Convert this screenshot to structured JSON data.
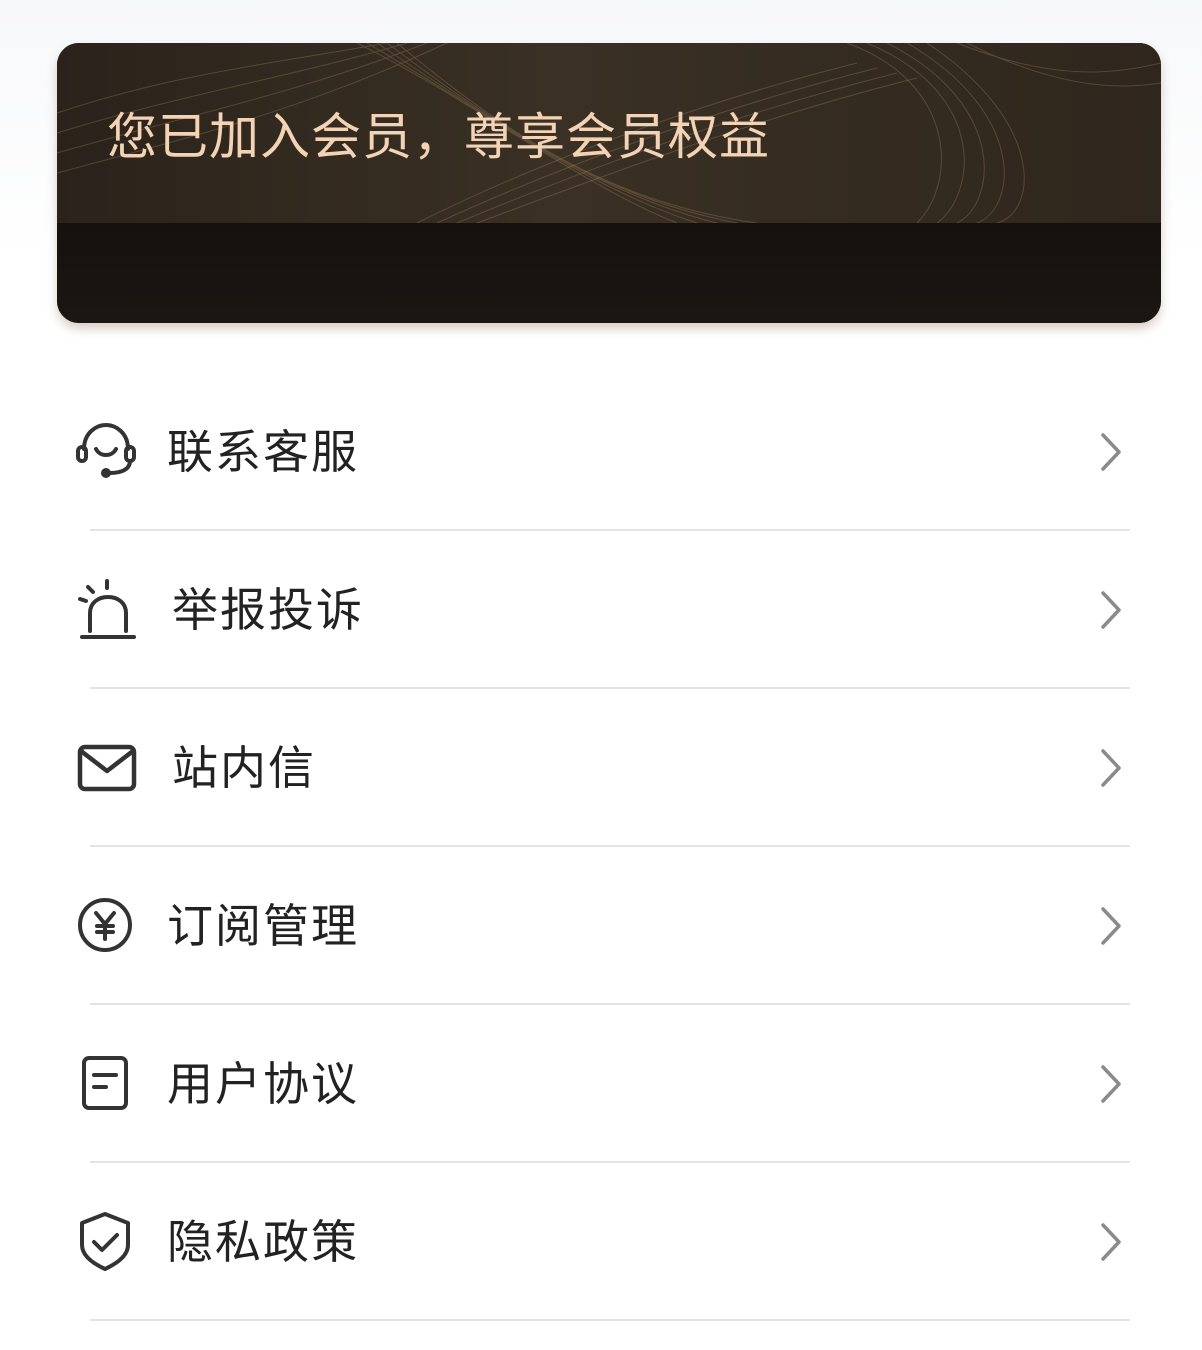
{
  "banner": {
    "text": "您已加入会员，尊享会员权益",
    "text_color": "#f3d3b5",
    "background_color": "#1a1511"
  },
  "menu": {
    "items": [
      {
        "label": "联系客服",
        "icon": "headset-icon"
      },
      {
        "label": "举报投诉",
        "icon": "alarm-siren-icon"
      },
      {
        "label": "站内信",
        "icon": "mail-icon"
      },
      {
        "label": "订阅管理",
        "icon": "yen-coin-icon"
      },
      {
        "label": "用户协议",
        "icon": "document-icon"
      },
      {
        "label": "隐私政策",
        "icon": "shield-check-icon"
      }
    ]
  }
}
